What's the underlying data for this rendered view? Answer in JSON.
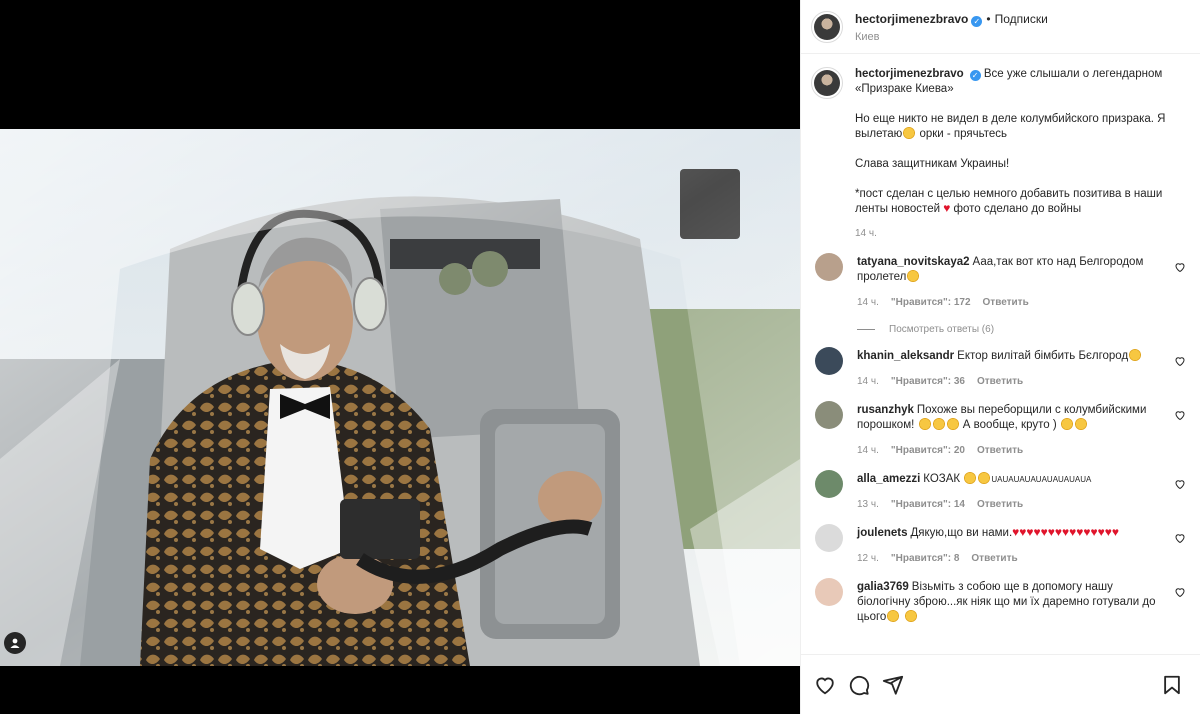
{
  "post": {
    "author": "hectorjimenezbravo",
    "verified": true,
    "follow_label": "Подписки",
    "location": "Киев"
  },
  "caption": {
    "text_p1": "Все уже слышали о легендарном «Призраке Киева»",
    "text_p2": "Но еще никто не видел в деле колумбийского призрака. Я вылетаю",
    "text_p2_end": "орки - прячьтесь",
    "text_p3": "Слава защитникам Украины!",
    "text_p4a": "*пост сделан с целью немного добавить позитива в наши ленты новостей",
    "text_p4b": "фото сделано до войны",
    "time": "14 ч."
  },
  "comments": [
    {
      "user": "tatyana_novitskaya2",
      "text": "Ааа,так вот кто над Белгородом пролетел",
      "time": "14 ч.",
      "likes": "\"Нравится\": 172",
      "reply": "Ответить",
      "replies": "Посмотреть ответы (6)"
    },
    {
      "user": "khanin_aleksandr",
      "text": "Ектор вилітай бімбить Бєлгород",
      "time": "14 ч.",
      "likes": "\"Нравится\": 36",
      "reply": "Ответить"
    },
    {
      "user": "rusanzhyk",
      "text": "Похоже вы переборщили с колумбийскими порошком!",
      "text_end": "А вообще, круто )",
      "time": "14 ч.",
      "likes": "\"Нравится\": 20",
      "reply": "Ответить"
    },
    {
      "user": "alla_amezzi",
      "text": "КОЗАК",
      "text_end": "UAUAUAUAUAUAUAUAUA",
      "time": "13 ч.",
      "likes": "\"Нравится\": 14",
      "reply": "Ответить"
    },
    {
      "user": "joulenets",
      "text": "Дякую,що ви нами.",
      "time": "12 ч.",
      "likes": "\"Нравится\": 8",
      "reply": "Ответить"
    },
    {
      "user": "galia3769",
      "text": "Візьміть з собою ще в допомогу нашу біологічну зброю...як ніяк що ми їх даремно готували до цього"
    }
  ],
  "icons": {
    "like": "heart-icon",
    "comment": "comment-icon",
    "share": "share-icon",
    "save": "bookmark-icon",
    "verified": "verified-badge-icon",
    "tag": "user-tag-icon"
  },
  "colors": {
    "accent": "#3897f0",
    "heart": "#e0142b",
    "muted": "#8e8e8e"
  }
}
